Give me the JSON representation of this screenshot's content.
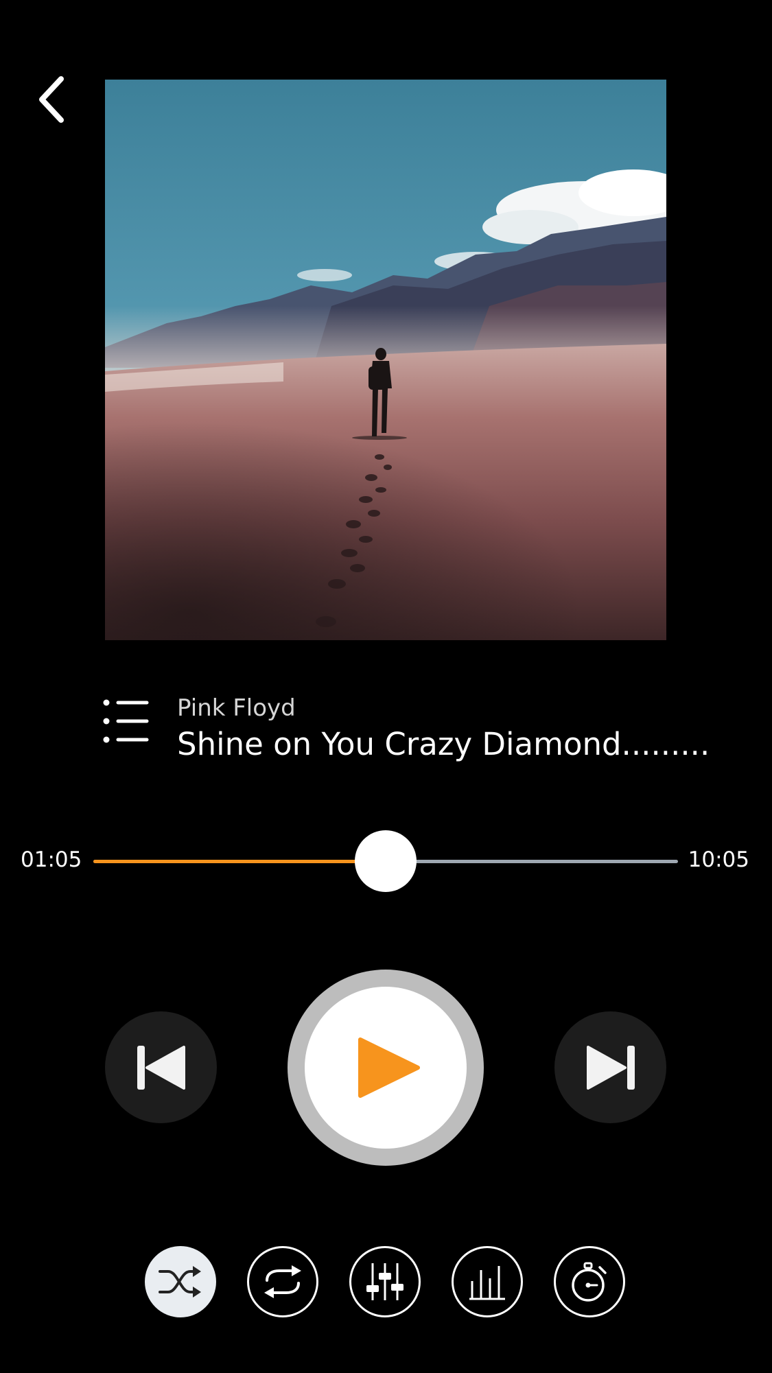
{
  "track": {
    "artist": "Pink Floyd",
    "title": "Shine on You Crazy Diamond........."
  },
  "progress": {
    "elapsed": "01:05",
    "total": "10:05",
    "fraction": 0.5
  },
  "colors": {
    "accent": "#f7941d",
    "background": "#000000",
    "track_remaining": "#9ea7b1",
    "button_dark": "#1d1d1d",
    "play_ring": "#bdbdbd",
    "active_option_bg": "#e9edf1"
  },
  "controls": {
    "previous_icon": "skip-previous-icon",
    "play_icon": "play-icon",
    "next_icon": "skip-next-icon"
  },
  "options": [
    {
      "icon": "shuffle-icon",
      "active": true
    },
    {
      "icon": "repeat-icon",
      "active": false
    },
    {
      "icon": "mixer-sliders-icon",
      "active": false
    },
    {
      "icon": "equalizer-icon",
      "active": false
    },
    {
      "icon": "timer-icon",
      "active": false
    }
  ]
}
